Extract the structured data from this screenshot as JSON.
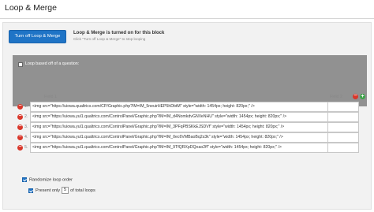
{
  "header": {
    "title": "Loop & Merge"
  },
  "panel": {
    "turn_off_button": "Turn off Loop & Merge",
    "status": "Loop & Merge is turned on for this block",
    "status_sub": "Click \"Turn off Loop & Merge\" to stop looping",
    "based_label": "Loop based off of a question:"
  },
  "grid": {
    "field1_label": "Field 1",
    "field2_label": "Field 2",
    "rows": [
      {
        "num": "1.",
        "field1": "<img src=\"https://uiowa.qualtrics.com/CP/Graphic.php?IM=IM_5neuirHEP5hDbtM\" style=\"width: 1454px; height: 820px;\" />",
        "field2": ""
      },
      {
        "num": "2.",
        "field1": "<img src=\"https://uiowa.yul1.qualtrics.com/ControlPanel/Graphic.php?IM=IM_d4NomkdvGNVeNHU\" style=\"width: 1454px; height: 820px;\" />",
        "field2": ""
      },
      {
        "num": "3.",
        "field1": "<img src=\"https://uiowa.yul1.qualtrics.com/ControlPanel/Graphic.php?IM=IM_3PFqPBSKkEJSDVf\" style=\"width: 1454px; height: 820px;\" />",
        "field2": ""
      },
      {
        "num": "4.",
        "field1": "<img src=\"https://uiowa.yul1.qualtrics.com/ControlPanel/Graphic.php?IM=IM_0ec6VMBaoBq2s3k\" style=\"width: 1454px; height: 820px;\" />",
        "field2": ""
      },
      {
        "num": "5.",
        "field1": "<img src=\"https://uiowa.yul1.qualtrics.com/ControlPanel/Graphic.php?IM=IM_9TfQRXpDQoao2ff\" style=\"width: 1454px; height: 820px;\" />",
        "field2": ""
      }
    ]
  },
  "options": {
    "randomize_label": "Randomize loop order",
    "present_prefix": "Present only",
    "present_value": "5",
    "present_suffix": "of total loops"
  },
  "colors": {
    "button": "#1f74c6",
    "remove": "#d9372b",
    "add": "#3ea44a",
    "panel_dark": "#919191"
  }
}
